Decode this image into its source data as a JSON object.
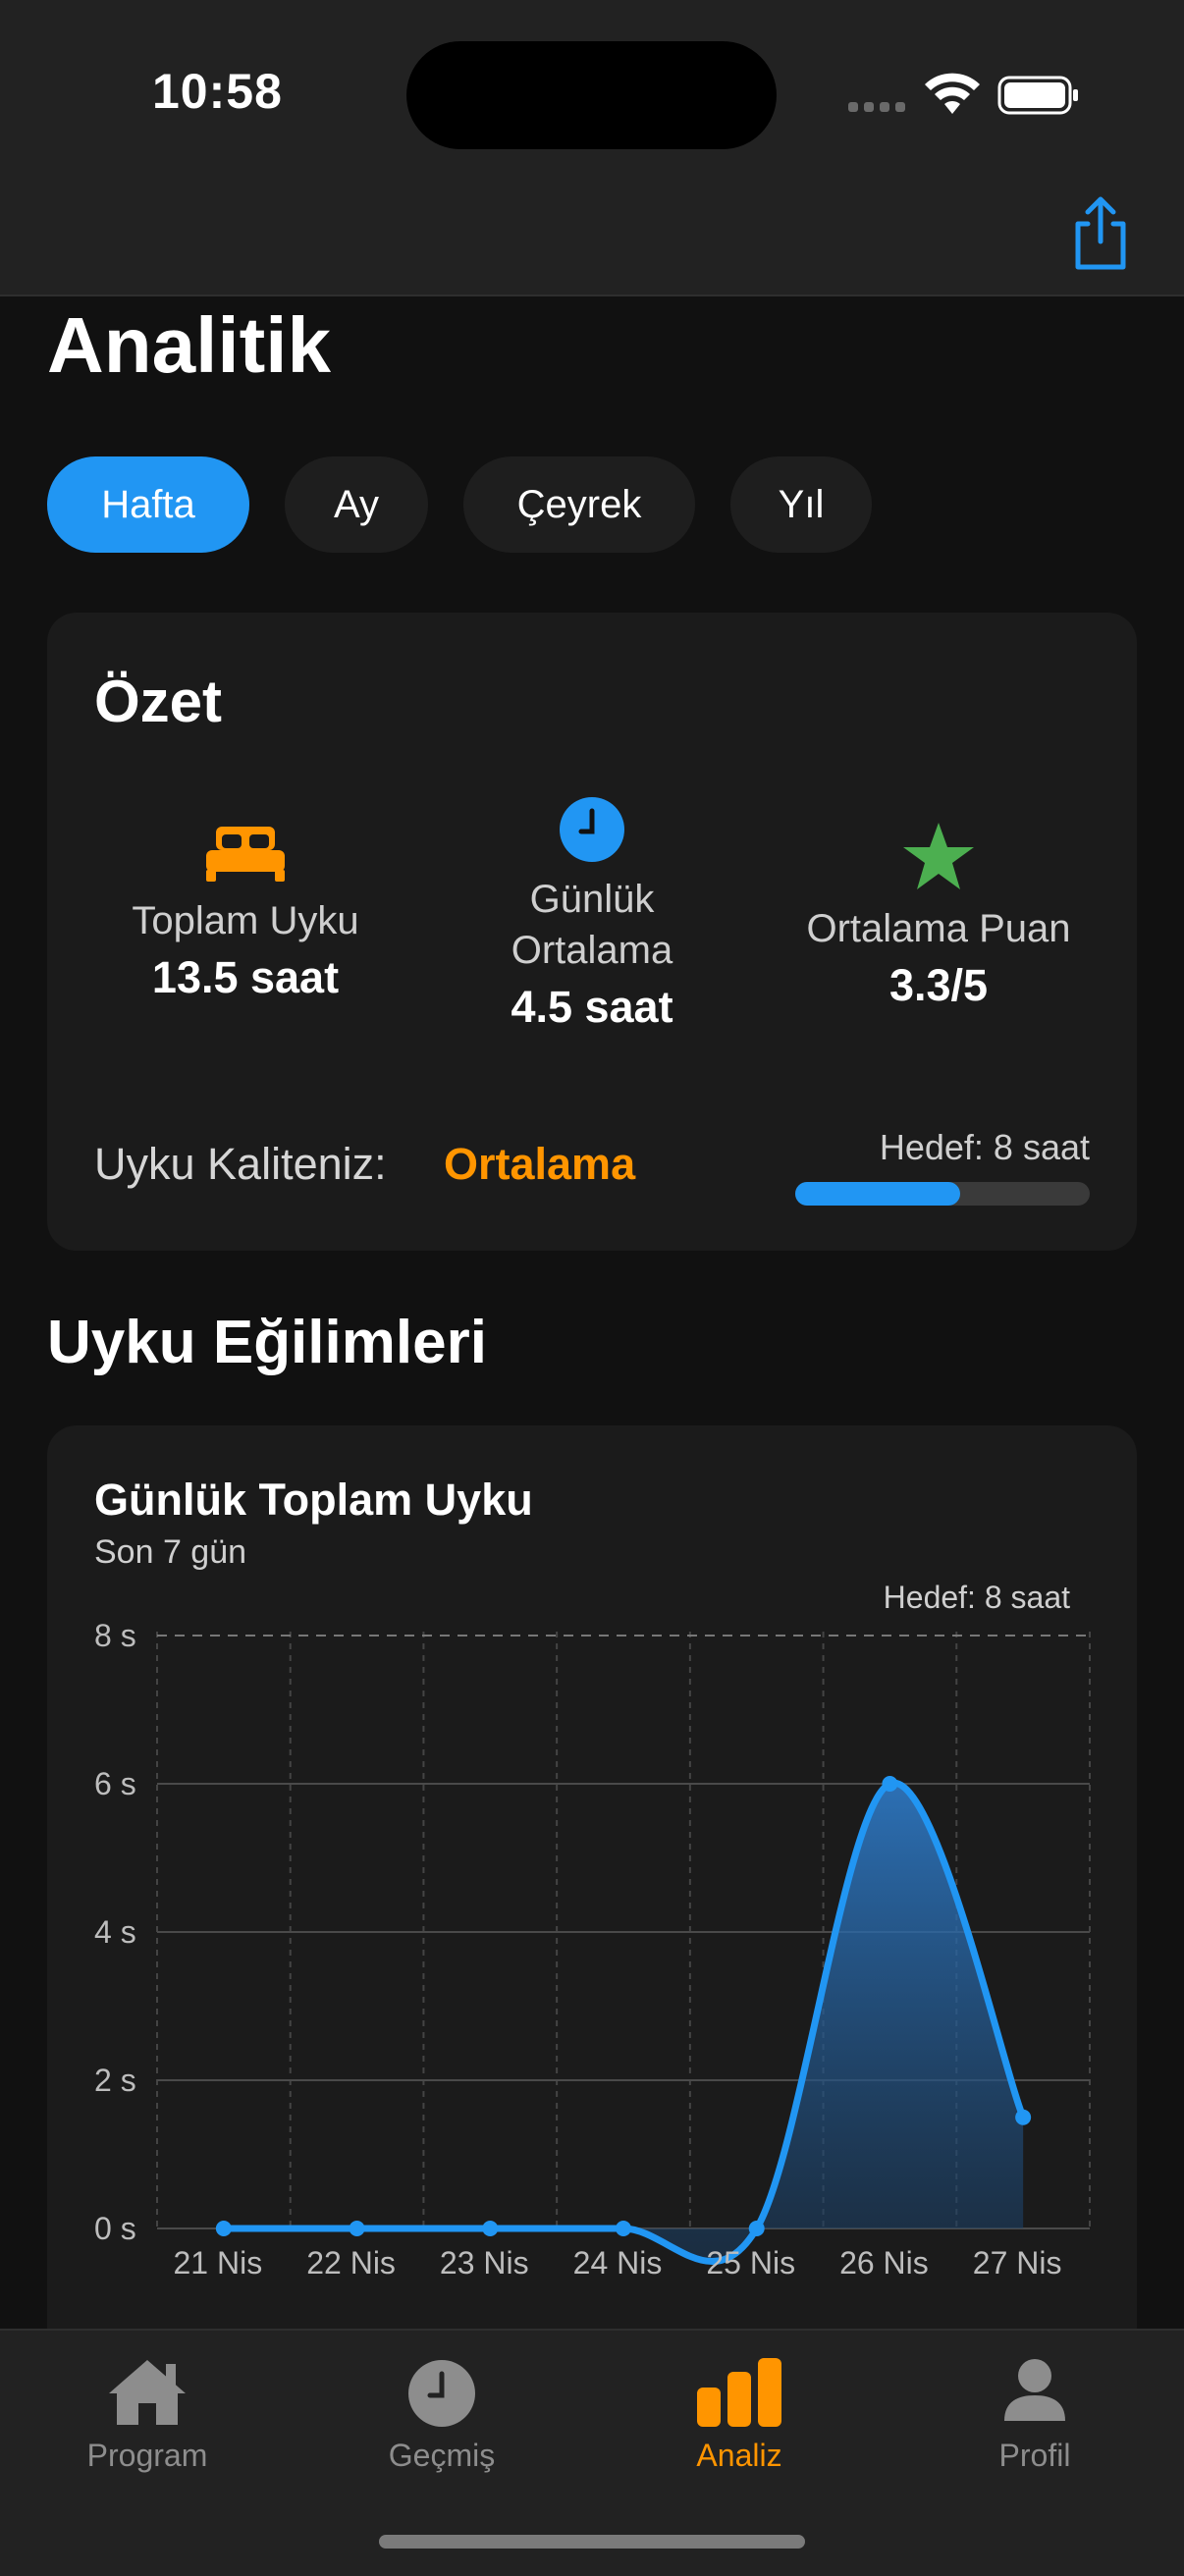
{
  "status": {
    "time": "10:58"
  },
  "header": {
    "title": "Analitik"
  },
  "period_tabs": [
    {
      "label": "Hafta",
      "active": true
    },
    {
      "label": "Ay",
      "active": false
    },
    {
      "label": "Çeyrek",
      "active": false
    },
    {
      "label": "Yıl",
      "active": false
    }
  ],
  "summary": {
    "title": "Özet",
    "stats": [
      {
        "icon": "bed-icon",
        "label": "Toplam Uyku",
        "value": "13.5 saat",
        "color": "#ff9500"
      },
      {
        "icon": "clock-icon",
        "label_line1": "Günlük",
        "label_line2": "Ortalama",
        "value": "4.5 saat",
        "color": "#2196f3"
      },
      {
        "icon": "star-icon",
        "label": "Ortalama Puan",
        "value": "3.3/5",
        "color": "#4caf50"
      }
    ],
    "quality_label": "Uyku Kaliteniz:",
    "quality_value": "Ortalama",
    "goal_text": "Hedef: 8 saat",
    "goal_progress": 0.56
  },
  "trends": {
    "section_title": "Uyku Eğilimleri",
    "chart_title": "Günlük Toplam Uyku",
    "chart_subtitle": "Son 7 gün"
  },
  "chart_data": {
    "type": "area",
    "categories": [
      "21 Nis",
      "22 Nis",
      "23 Nis",
      "24 Nis",
      "25 Nis",
      "26 Nis",
      "27 Nis"
    ],
    "values": [
      0,
      0,
      0,
      0,
      0,
      6.0,
      1.5
    ],
    "y_ticks": [
      "0 s",
      "2 s",
      "4 s",
      "6 s",
      "8 s"
    ],
    "ylim": [
      0,
      8
    ],
    "goal_line": 8,
    "goal_label": "Hedef: 8 saat",
    "line_color": "#2196f3",
    "grid": true
  },
  "tab_bar": {
    "items": [
      {
        "label": "Program",
        "icon": "house-icon",
        "active": false
      },
      {
        "label": "Geçmiş",
        "icon": "clock-icon",
        "active": false
      },
      {
        "label": "Analiz",
        "icon": "bar-chart-icon",
        "active": true
      },
      {
        "label": "Profil",
        "icon": "person-icon",
        "active": false
      }
    ]
  },
  "colors": {
    "accent": "#2196f3",
    "highlight": "#ff9500",
    "success": "#4caf50",
    "background": "#111111"
  }
}
